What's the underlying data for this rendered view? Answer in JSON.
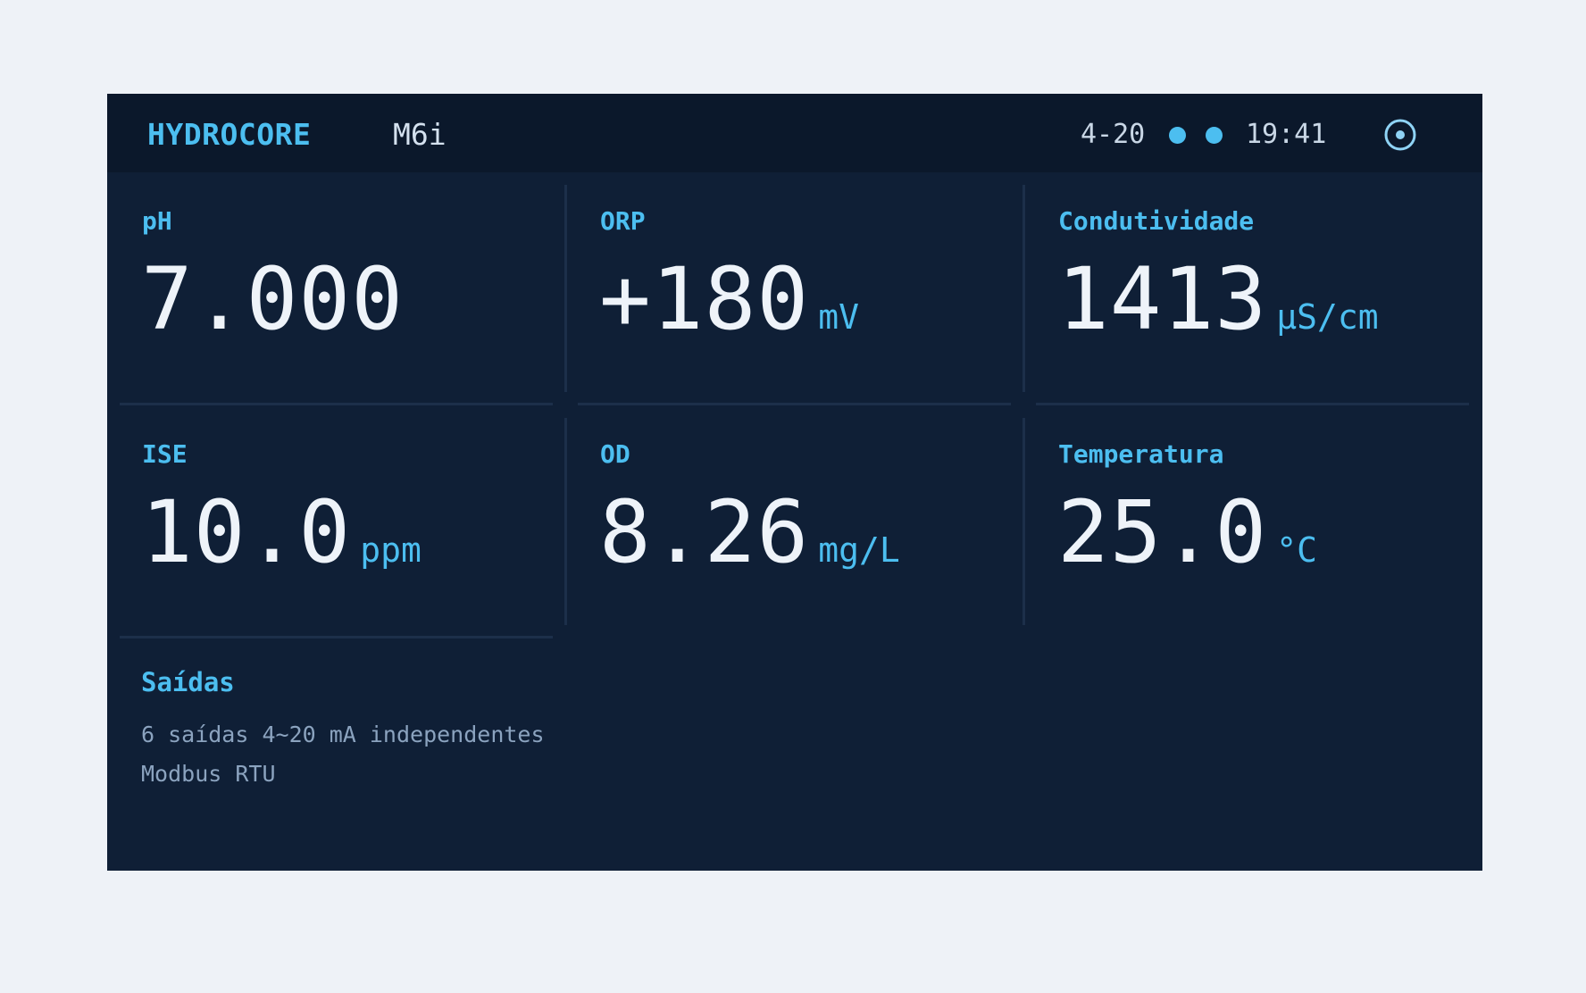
{
  "header": {
    "brand": "HYDROCORE",
    "model": "M6i",
    "signal": "4-20",
    "time": "19:41"
  },
  "icons": {
    "status_dot_1": "status-dot-icon",
    "status_dot_2": "status-dot-icon",
    "settings": "target-icon"
  },
  "colors": {
    "accent": "#4cbef0",
    "background": "#0f1f36",
    "topbar": "#0b182b",
    "value": "#eef3f9",
    "muted": "#8ba3bf"
  },
  "readings": [
    {
      "label": "pH",
      "value": "7.000",
      "unit": ""
    },
    {
      "label": "ORP",
      "value": "+180",
      "unit": "mV"
    },
    {
      "label": "Condutividade",
      "value": "1413",
      "unit": "µS/cm"
    },
    {
      "label": "ISE",
      "value": "10.0",
      "unit": "ppm"
    },
    {
      "label": "OD",
      "value": "8.26",
      "unit": "mg/L"
    },
    {
      "label": "Temperatura",
      "value": "25.0",
      "unit": "°C"
    }
  ],
  "outputs": {
    "title": "Saídas",
    "line1": "6 saídas 4~20 mA independentes",
    "line2": "Modbus RTU"
  }
}
